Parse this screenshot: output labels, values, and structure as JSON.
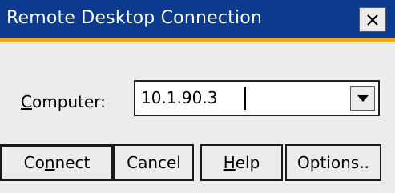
{
  "window": {
    "title": "Remote Desktop Connection",
    "close_glyph": "✕"
  },
  "colors": {
    "titlebar": "#0b3a8f",
    "titlebar_accent": "#f7a21b",
    "background": "#ececec"
  },
  "form": {
    "computer_label_prefix": "",
    "computer_label_mnemonic": "C",
    "computer_label_rest": "omputer:",
    "computer_value": "10.1.90.3",
    "dropdown_icon": "chevron-down-icon"
  },
  "buttons": {
    "connect": {
      "pre": "Co",
      "mnemonic": "n",
      "post": "nect"
    },
    "cancel": {
      "label": "Cancel"
    },
    "help": {
      "pre": "",
      "mnemonic": "H",
      "post": "elp"
    },
    "options": {
      "label": "Options.."
    }
  }
}
